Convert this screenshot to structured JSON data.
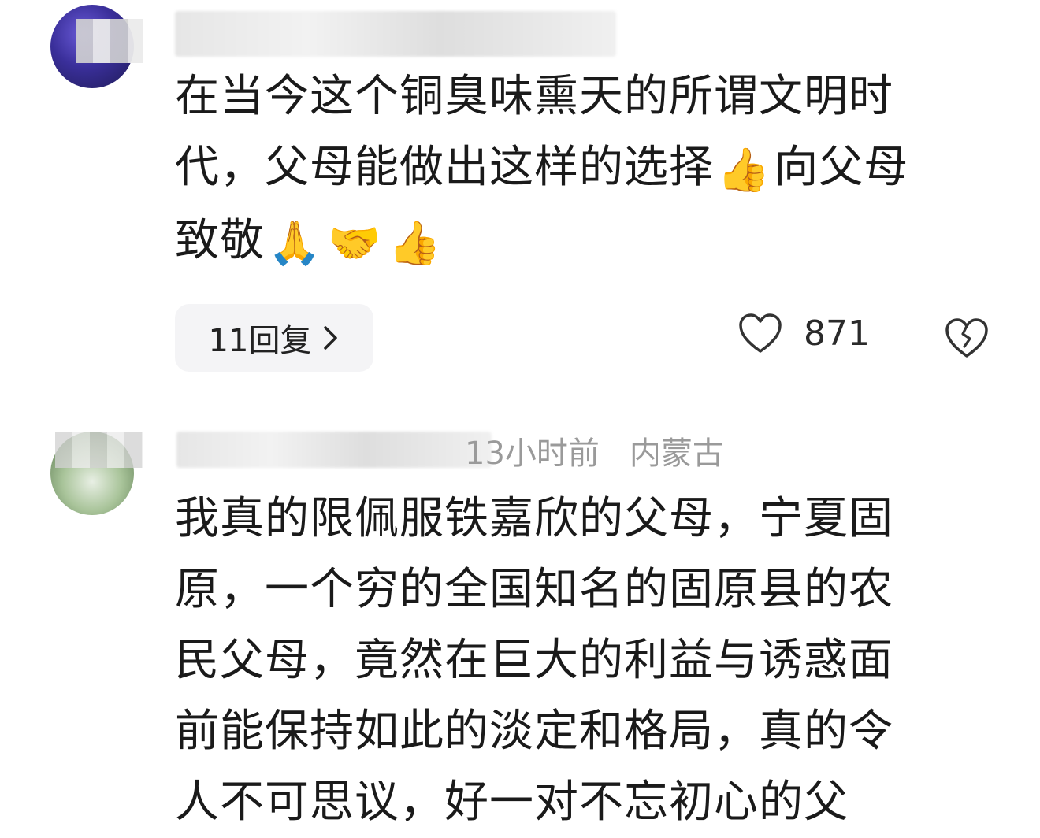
{
  "comments": [
    {
      "text_lines": [
        "在当今这个铜臭味熏天的所谓文明时",
        "代，父母能做出这样的选择",
        "向父母",
        "致敬"
      ],
      "emojis": [
        "👍",
        "🙏",
        "🤝",
        "👍"
      ],
      "replies_label": "11回复",
      "likes": "871"
    },
    {
      "time": "13小时前",
      "location": "内蒙古",
      "text_lines": [
        "我真的限佩服铁嘉欣的父母，宁夏固",
        "原，一个穷的全国知名的固原县的农",
        "民父母，竟然在巨大的利益与诱惑面",
        "前能保持如此的淡定和格局，真的令",
        "人不可思议，好一对不忘初心的父"
      ]
    }
  ],
  "icons": {
    "like": "heart-outline-icon",
    "dislike": "broken-heart-icon",
    "reply_chevron": "chevron-right-icon"
  }
}
